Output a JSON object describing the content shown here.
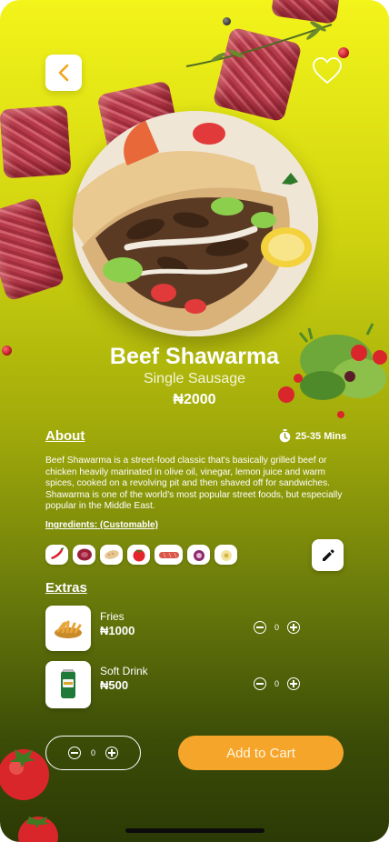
{
  "product": {
    "name": "Beef Shawarma",
    "variant": "Single Sausage",
    "price": "₦2000"
  },
  "about": {
    "heading": "About",
    "prep_time": "25-35 Mins",
    "description": "Beef Shawarma is a street-food classic that's basically grilled beef or chicken heavily marinated in olive oil, vinegar, lemon juice and warm spices, cooked on a revolving pit and then shaved off for sandwiches. Shawarma is one of the world's most popular street foods, but especially popular in the Middle East."
  },
  "ingredients": {
    "heading": "Ingredients: (Customable)",
    "items": [
      "chili-pepper",
      "beef",
      "bread",
      "tomato",
      "sausage",
      "onion",
      "garlic"
    ]
  },
  "extras": {
    "heading": "Extras",
    "items": [
      {
        "name": "Fries",
        "price": "₦1000",
        "qty": "0",
        "icon": "fries-icon"
      },
      {
        "name": "Soft Drink",
        "price": "₦500",
        "qty": "0",
        "icon": "soda-can-icon"
      }
    ]
  },
  "cart": {
    "qty": "0",
    "button_label": "Add to Cart"
  },
  "colors": {
    "accent": "#f6a52b",
    "gradient_top": "#f3f41a",
    "gradient_bottom": "#2c3a06"
  }
}
